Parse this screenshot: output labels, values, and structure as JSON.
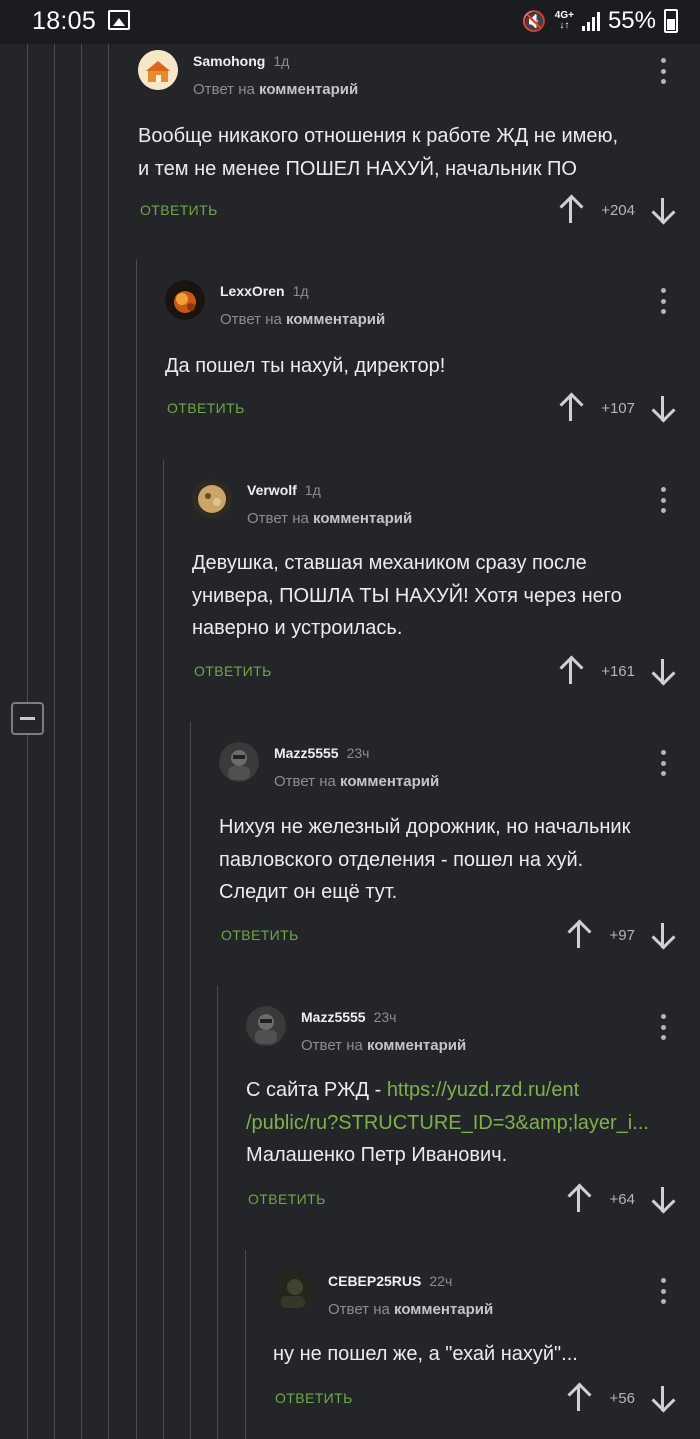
{
  "status_bar": {
    "time": "18:05",
    "network": "4G+",
    "battery": "55%"
  },
  "comments": [
    {
      "author": "Samohong",
      "time": "1д",
      "reply_prefix": "Ответ на",
      "reply_target": "комментарий",
      "lines": [
        "Вообще никакого отношения к работе ЖД не имею,",
        "и тем не менее ПОШЕЛ НАХУЙ, начальник ПО"
      ],
      "reply_label": "ОТВЕТИТЬ",
      "rating": "+204",
      "avatar_color": "#f5e0c0"
    },
    {
      "author": "LexxOren",
      "time": "1д",
      "reply_prefix": "Ответ на",
      "reply_target": "комментарий",
      "lines": [
        "Да пошел ты нахуй, директор!"
      ],
      "reply_label": "ОТВЕТИТЬ",
      "rating": "+107",
      "avatar_color": "#7a3b12"
    },
    {
      "author": "Verwolf",
      "time": "1д",
      "reply_prefix": "Ответ на",
      "reply_target": "комментарий",
      "lines": [
        "Девушка, ставшая механиком сразу после",
        "универа, ПОШЛА ТЫ НАХУЙ! Хотя через него",
        "наверно и устроилась."
      ],
      "reply_label": "ОТВЕТИТЬ",
      "rating": "+161",
      "avatar_color": "#c9a56a"
    },
    {
      "author": "Mazz5555",
      "time": "23ч",
      "reply_prefix": "Ответ на",
      "reply_target": "комментарий",
      "lines": [
        "Нихуя не железный дорожник, но начальник",
        "павловского отделения - пошел на хуй.",
        "Следит он ещё тут."
      ],
      "reply_label": "ОТВЕТИТЬ",
      "rating": "+97",
      "avatar_color": "#555555"
    },
    {
      "author": "Mazz5555",
      "time": "23ч",
      "reply_prefix": "Ответ на",
      "reply_target": "комментарий",
      "line1_prefix": "С сайта РЖД - ",
      "link_line1": "https://yuzd.rzd.ru/ent",
      "link_line2": "/public/ru?STRUCTURE_ID=3&amp;layer_i...",
      "line3": "Малашенко Петр Иванович.",
      "reply_label": "ОТВЕТИТЬ",
      "rating": "+64",
      "avatar_color": "#555555"
    },
    {
      "author": "СЕВЕР25RUS",
      "time": "22ч",
      "reply_prefix": "Ответ на",
      "reply_target": "комментарий",
      "lines": [
        "ну не пошел же, а \"ехай нахуй\"..."
      ],
      "reply_label": "ОТВЕТИТЬ",
      "rating": "+56",
      "avatar_color": "#2c2f22"
    }
  ]
}
